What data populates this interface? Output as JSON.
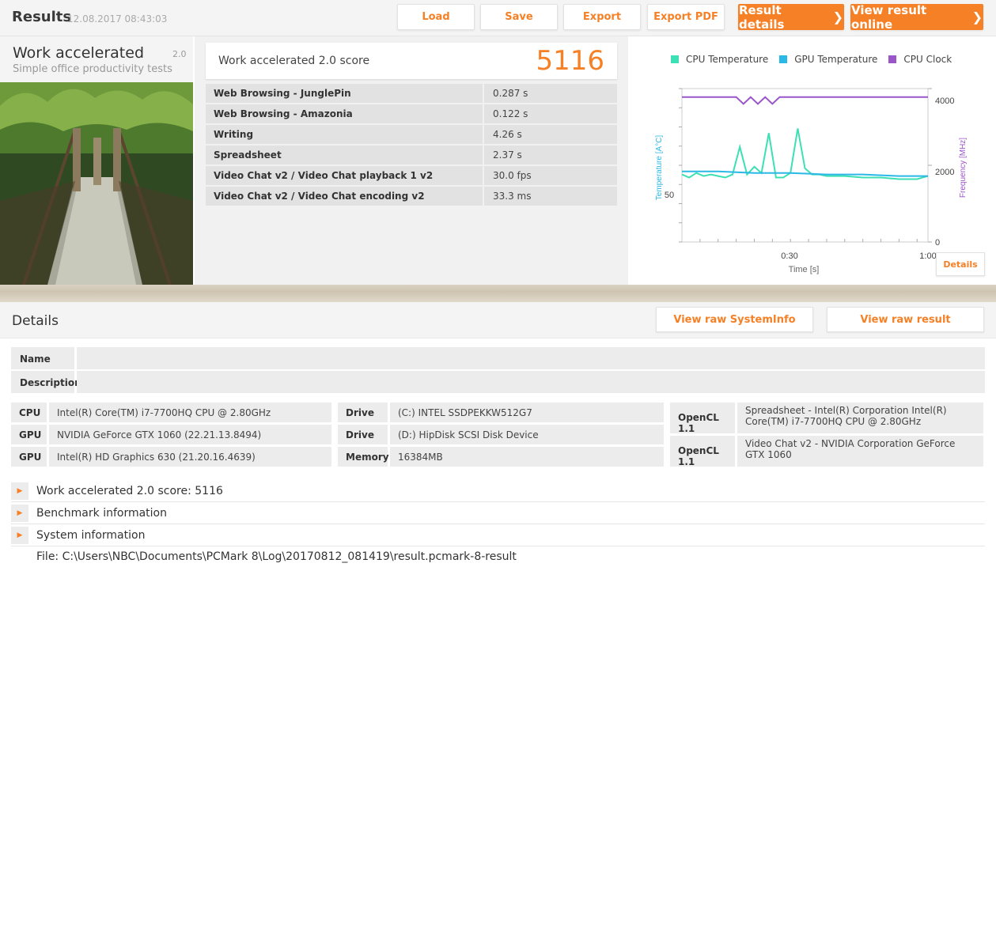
{
  "header": {
    "title": "Results",
    "timestamp": "12.08.2017 08:43:03",
    "buttons": {
      "load": "Load",
      "save": "Save",
      "export": "Export",
      "export_pdf": "Export PDF",
      "result_details": "Result details",
      "view_online": "View result online"
    }
  },
  "benchmark": {
    "name": "Work accelerated",
    "version": "2.0",
    "subtitle": "Simple office productivity tests"
  },
  "score": {
    "label": "Work accelerated 2.0 score",
    "value": "5116"
  },
  "results": [
    {
      "name": "Web Browsing - JunglePin",
      "value": "0.287 s"
    },
    {
      "name": "Web Browsing - Amazonia",
      "value": "0.122 s"
    },
    {
      "name": "Writing",
      "value": "4.26 s"
    },
    {
      "name": "Spreadsheet",
      "value": "2.37 s"
    },
    {
      "name": "Video Chat v2 / Video Chat playback 1 v2",
      "value": "30.0 fps"
    },
    {
      "name": "Video Chat v2 / Video Chat encoding v2",
      "value": "33.3 ms"
    }
  ],
  "chart_data": {
    "type": "line",
    "legend": [
      "CPU Temperature",
      "GPU Temperature",
      "CPU Clock"
    ],
    "xlabel": "Time [s]",
    "ylabel_left": "Temperature [A°C]",
    "ylabel_right": "Frequency [MHz]",
    "x_ticks": [
      "0:30",
      "1:00"
    ],
    "y_left_ticks": [
      "50"
    ],
    "y_right_ticks": [
      "4000",
      "2000",
      "0"
    ],
    "xlim": [
      0,
      68
    ],
    "ylim_right": [
      0,
      4000
    ],
    "colors": {
      "cpu_temp": "#3de0b5",
      "gpu_temp": "#2ab8e6",
      "cpu_clock": "#9a55c9"
    },
    "series": [
      {
        "name": "CPU Clock",
        "axis": "right",
        "x": [
          0,
          15,
          17,
          19,
          21,
          23,
          25,
          27,
          68
        ],
        "y": [
          3780,
          3780,
          3600,
          3780,
          3600,
          3780,
          3600,
          3780,
          3780
        ]
      },
      {
        "name": "CPU Temperature",
        "axis": "left",
        "x": [
          0,
          2,
          4,
          6,
          8,
          10,
          12,
          14,
          16,
          18,
          20,
          22,
          24,
          26,
          28,
          30,
          32,
          34,
          36,
          38,
          40,
          45,
          50,
          55,
          60,
          65,
          68
        ],
        "y": [
          0.44,
          0.42,
          0.45,
          0.43,
          0.44,
          0.43,
          0.42,
          0.44,
          0.62,
          0.44,
          0.49,
          0.45,
          0.71,
          0.42,
          0.42,
          0.45,
          0.74,
          0.48,
          0.44,
          0.44,
          0.43,
          0.43,
          0.42,
          0.42,
          0.41,
          0.41,
          0.43
        ]
      },
      {
        "name": "GPU Temperature",
        "axis": "left",
        "x": [
          0,
          10,
          20,
          30,
          40,
          50,
          60,
          68
        ],
        "y": [
          0.46,
          0.46,
          0.45,
          0.45,
          0.44,
          0.44,
          0.43,
          0.43
        ]
      }
    ]
  },
  "chart_details_button": "Details",
  "details": {
    "title": "Details",
    "view_raw_systeminfo": "View raw SystemInfo",
    "view_raw_result": "View raw result",
    "name_label": "Name",
    "description_label": "Description",
    "system": {
      "col1": [
        {
          "k": "CPU",
          "v": "Intel(R) Core(TM) i7-7700HQ CPU @ 2.80GHz"
        },
        {
          "k": "GPU",
          "v": "NVIDIA GeForce GTX 1060 (22.21.13.8494)"
        },
        {
          "k": "GPU",
          "v": "Intel(R) HD Graphics 630 (21.20.16.4639)"
        }
      ],
      "col2": [
        {
          "k": "Drive",
          "v": "(C:) INTEL SSDPEKKW512G7"
        },
        {
          "k": "Drive",
          "v": "(D:) HipDisk  SCSI Disk Device"
        },
        {
          "k": "Memory",
          "v": "16384MB"
        }
      ],
      "opencl": [
        {
          "k": "OpenCL 1.1",
          "v": "Spreadsheet - Intel(R) Corporation Intel(R) Core(TM) i7-7700HQ CPU @ 2.80GHz"
        },
        {
          "k": "OpenCL 1.1",
          "v": "Video Chat v2 - NVIDIA Corporation GeForce GTX 1060"
        }
      ]
    },
    "expanders": [
      "Work accelerated 2.0 score: 5116",
      "Benchmark information",
      "System information"
    ],
    "file": "File: C:\\Users\\NBC\\Documents\\PCMark 8\\Log\\20170812_081419\\result.pcmark-8-result"
  }
}
